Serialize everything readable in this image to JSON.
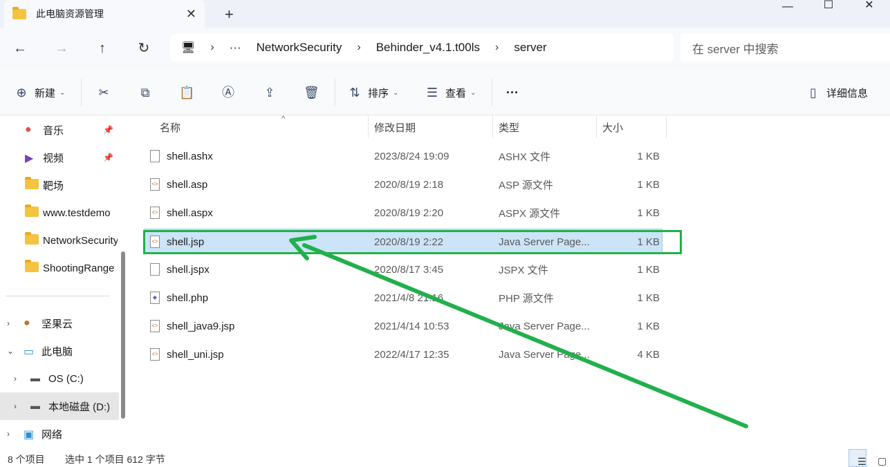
{
  "window": {
    "tab_title": "此电脑资源管理",
    "tab_close": "✕",
    "new_tab": "+",
    "minimize": "—",
    "maximize": "☐",
    "close": "✕"
  },
  "nav": {
    "back_icon": "←",
    "forward_icon": "→",
    "up_icon": "↑",
    "refresh_icon": "↻",
    "pc_icon": "🖥",
    "more_crumbs": "···",
    "breadcrumbs": [
      "NetworkSecurity",
      "Behinder_v4.1.t00ls",
      "server"
    ],
    "separator": "›",
    "search_placeholder": "在 server 中搜索"
  },
  "command_bar": {
    "new_label": "新建",
    "sort_label": "排序",
    "view_label": "查看",
    "more": "···",
    "details_label": "详细信息",
    "caret": "⌄"
  },
  "sidebar": {
    "pinned": [
      {
        "label": "音乐",
        "icon": "music-icon"
      },
      {
        "label": "视频",
        "icon": "video-icon"
      },
      {
        "label": "靶场",
        "icon": "folder-icon"
      },
      {
        "label": "www.testdemo",
        "icon": "folder-icon"
      },
      {
        "label": "NetworkSecurity",
        "icon": "folder-icon"
      },
      {
        "label": "ShootingRange",
        "icon": "folder-icon"
      }
    ],
    "tree": [
      {
        "label": "坚果云",
        "icon": "nutstore-icon"
      },
      {
        "label": "此电脑",
        "icon": "pc-icon"
      },
      {
        "label": "OS (C:)",
        "icon": "drive-icon"
      },
      {
        "label": "本地磁盘 (D:)",
        "icon": "drive-icon"
      },
      {
        "label": "网络",
        "icon": "network-icon"
      }
    ],
    "chev_right": "›",
    "chev_down": "⌄",
    "pin": "📌"
  },
  "columns": {
    "name": "名称",
    "modified": "修改日期",
    "type": "类型",
    "size": "大小",
    "sort_caret": "^"
  },
  "files": [
    {
      "name": "shell.ashx",
      "date": "2023/8/24 19:09",
      "type": "ASHX 文件",
      "size": "1 KB"
    },
    {
      "name": "shell.asp",
      "date": "2020/8/19 2:18",
      "type": "ASP 源文件",
      "size": "1 KB"
    },
    {
      "name": "shell.aspx",
      "date": "2020/8/19 2:20",
      "type": "ASPX 源文件",
      "size": "1 KB"
    },
    {
      "name": "shell.jsp",
      "date": "2020/8/19 2:22",
      "type": "Java Server Page...",
      "size": "1 KB",
      "selected": true
    },
    {
      "name": "shell.jspx",
      "date": "2020/8/17 3:45",
      "type": "JSPX 文件",
      "size": "1 KB"
    },
    {
      "name": "shell.php",
      "date": "2021/4/8 21:16",
      "type": "PHP 源文件",
      "size": "1 KB"
    },
    {
      "name": "shell_java9.jsp",
      "date": "2021/4/14 10:53",
      "type": "Java Server Page...",
      "size": "1 KB"
    },
    {
      "name": "shell_uni.jsp",
      "date": "2022/4/17 12:35",
      "type": "Java Server Page...",
      "size": "4 KB"
    }
  ],
  "status": {
    "item_count": "8 个项目",
    "selection": "选中 1 个项目 612 字节"
  },
  "colors": {
    "accent": "#21b04b",
    "selection_bg": "#cce4f7"
  }
}
